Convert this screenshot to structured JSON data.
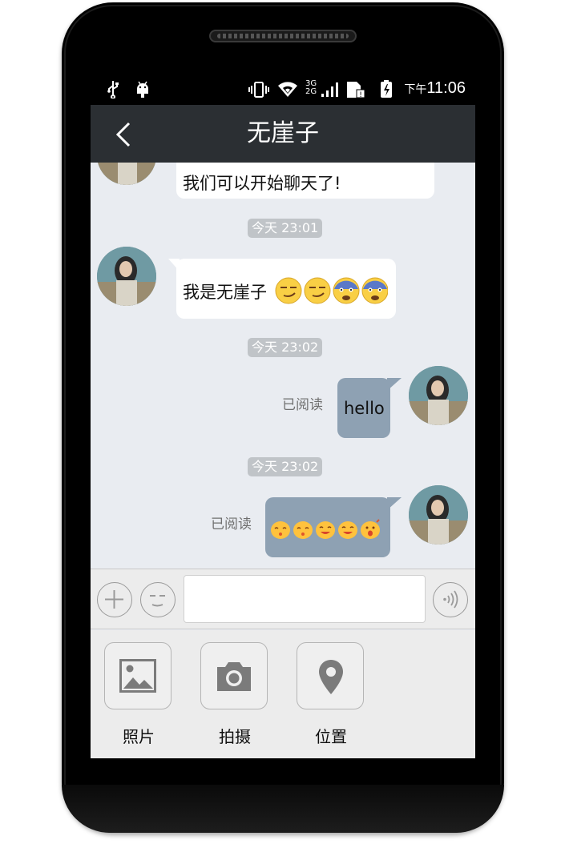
{
  "status_bar": {
    "time_prefix": "下午",
    "time": "11:06",
    "network_label_top": "3G",
    "network_label_bottom": "2G"
  },
  "header": {
    "title": "无崖子"
  },
  "messages": [
    {
      "type": "incoming",
      "text_partial": "我们可以开始聊天了!"
    },
    {
      "type": "time",
      "text": "今天 23:01"
    },
    {
      "type": "incoming",
      "text": "我是无崖子",
      "emoji": [
        "smirk",
        "smirk",
        "fearful",
        "fearful"
      ]
    },
    {
      "type": "time",
      "text": "今天 23:02"
    },
    {
      "type": "outgoing",
      "text": "hello",
      "status": "已阅读"
    },
    {
      "type": "time",
      "text": "今天 23:02"
    },
    {
      "type": "outgoing",
      "emoji": [
        "kiss",
        "kiss",
        "smile",
        "smile",
        "surprised"
      ],
      "status": "已阅读"
    }
  ],
  "composer": {
    "input_value": "",
    "input_placeholder": ""
  },
  "tray": {
    "items": [
      {
        "label": "照片",
        "icon": "image-icon"
      },
      {
        "label": "拍摄",
        "icon": "camera-icon"
      },
      {
        "label": "位置",
        "icon": "location-pin-icon"
      }
    ]
  },
  "colors": {
    "title_bar": "#2b2f33",
    "chat_bg": "#e9ecf1",
    "outgoing_bubble": "#8ea1b3",
    "incoming_bubble": "#ffffff",
    "time_chip": "#c0c4c8"
  }
}
